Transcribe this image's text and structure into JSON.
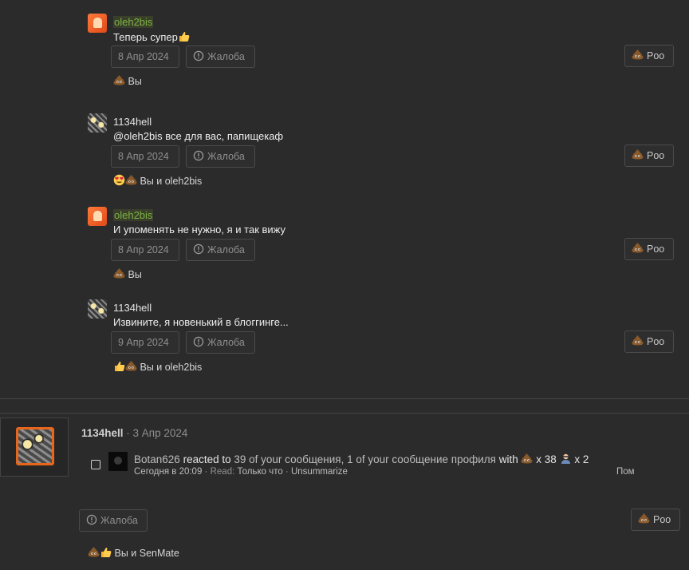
{
  "comments": [
    {
      "author": "oleh2bis",
      "text": "Теперь супер",
      "date": "8 Апр 2024",
      "report": "Жалоба",
      "reaction_btn": "Poo",
      "reactions_text": "Вы",
      "emojis": [
        "poo-icon"
      ]
    },
    {
      "author": "1134hell",
      "text": "@oleh2bis все для вас, папищекаф",
      "date": "8 Апр 2024",
      "report": "Жалоба",
      "reaction_btn": "Poo",
      "reactions_text": "Вы и oleh2bis",
      "emojis": [
        "heart-eyes-icon",
        "poo-icon"
      ]
    },
    {
      "author": "oleh2bis",
      "text": "И упоменять не нужно, я и так вижу",
      "date": "8 Апр 2024",
      "report": "Жалоба",
      "reaction_btn": "Poo",
      "reactions_text": "Вы",
      "emojis": [
        "poo-icon"
      ]
    },
    {
      "author": "1134hell",
      "text": "Извините, я новенький в блоггинге...",
      "date": "9 Апр 2024",
      "report": "Жалоба",
      "reaction_btn": "Poo",
      "reactions_text": "Вы и oleh2bis",
      "emojis": [
        "thumbs-up-icon",
        "poo-icon"
      ]
    }
  ],
  "profile_post": {
    "author": "1134hell",
    "date_sep": " · ",
    "date": "3 Апр 2024",
    "notification": {
      "user": "Botan626",
      "reacted": "reacted to",
      "count_msgs": "39 of your сообщения,",
      "count_profile": "1 of your сообщение профиля",
      "with": "with",
      "poo_count": "x 38",
      "other_count": "x 2",
      "time": "Сегодня в 20:09",
      "sep1": " · ",
      "read_label": "Read:",
      "read_value": "Только что",
      "sep2": " · ",
      "unsummarize": "Unsummarize",
      "right_truncated": "Пом"
    },
    "report": "Жалоба",
    "reaction_btn": "Poo",
    "reactions_text": "Вы и SenMate"
  },
  "colors": {
    "background": "#2b2b2b",
    "username_green": "#7cb342",
    "button_border": "#4b4b4b"
  }
}
